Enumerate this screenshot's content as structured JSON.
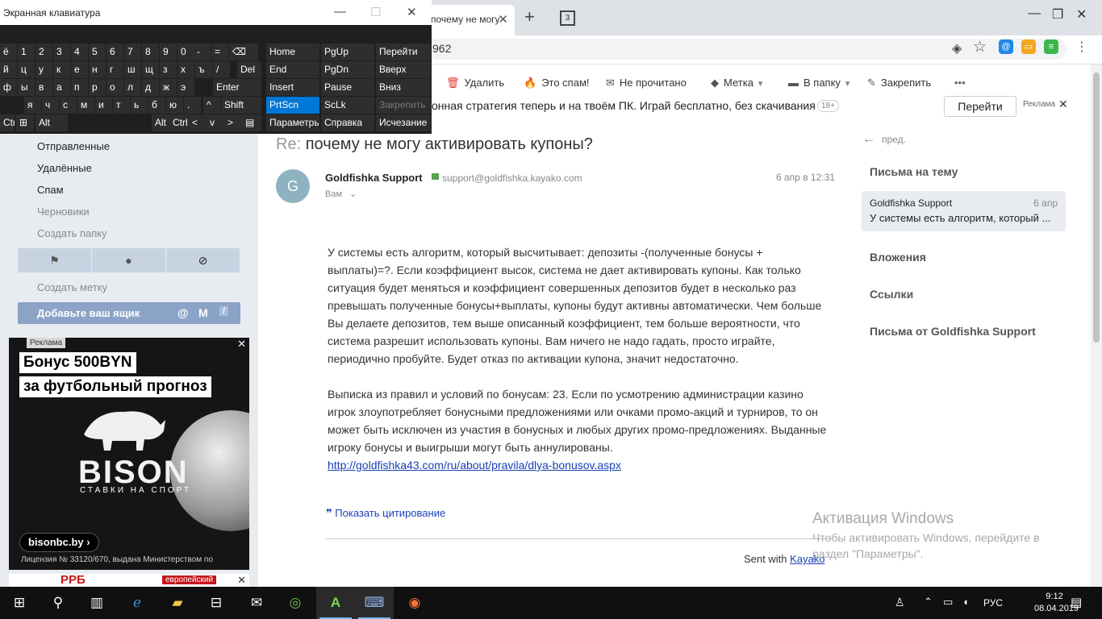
{
  "browser": {
    "tab_title": "почему не могу",
    "tab_count": "3",
    "url_fragment": "962"
  },
  "toolbar": {
    "delete": "Удалить",
    "spam": "Это спам!",
    "unread": "Не прочитано",
    "label": "Метка",
    "folder": "В папку",
    "pin": "Закрепить",
    "more": "•••"
  },
  "adstrip": {
    "text": "онная стратегия теперь и на твоём ПК. Играй бесплатно, без скачивания",
    "age": "18+",
    "go": "Перейти",
    "ad_label": "Реклама"
  },
  "sidebar": {
    "folders": [
      "Отправленные",
      "Удалённые",
      "Спам",
      "Черновики",
      "Создать папку"
    ],
    "create_label": "Создать метку",
    "add_box": "Добавьте ваш ящик"
  },
  "banner": {
    "ad_label": "Реклама",
    "line1": "Бонус 500BYN",
    "line2": "за футбольный прогноз",
    "brand": "BISON",
    "brand_sub": "СТАВКИ НА СПОРТ",
    "url": "bisonbc.by",
    "license": "Лицензия № 33120/670, выдана Министерством по",
    "banner2_brand": "РРБ",
    "banner2_tag": "европейский"
  },
  "email": {
    "subject_prefix": "Re:",
    "subject": "почему не могу активировать купоны?",
    "avatar_letter": "G",
    "sender": "Goldfishka Support",
    "sender_email": "support@goldfishka.kayako.com",
    "date": "6 апр в 12:31",
    "to": "Вам",
    "body_p1": "У системы есть алгоритм, который высчитывает: депозиты -(полученные бонусы + выплаты)=?. Если коэффициент высок, система не дает активировать купоны. Как только ситуация будет меняться и коэффициент совершенных депозитов будет в несколько раз превышать полученные бонусы+выплаты, купоны будут активны автоматически. Чем больше Вы делаете депозитов, тем выше описанный коэффициент, тем больше вероятности, что система разрешит использовать купоны. Вам ничего не надо гадать, просто играйте, периодично пробуйте. Будет отказ по активации купона, значит недостаточно.",
    "body_p2": "Выписка из правил и условий по бонусам: 23. Если по усмотрению администрации казино игрок злоупотребляет бонусными предложениями или очками промо-акций и турниров, то он может быть исключен из участия в бонусных и любых других промо-предложениях. Выданные игроку бонусы и выигрыши могут быть аннулированы.",
    "link": "http://goldfishka43.com/ru/about/pravila/dlya-bonusov.aspx",
    "show_quote": "Показать цитирование",
    "sent_with": "Sent with",
    "kayako": "Kayako"
  },
  "rightpanel": {
    "prev": "пред.",
    "thread_header": "Письма на тему",
    "thread_from": "Goldfishka Support",
    "thread_date": "6 апр",
    "thread_snippet": "У системы есть алгоритм, который ...",
    "attachments": "Вложения",
    "links": "Ссылки",
    "from_sender": "Письма от Goldfishka Support"
  },
  "watermark": {
    "title": "Активация Windows",
    "text": "Чтобы активировать Windows, перейдите в раздел \"Параметры\"."
  },
  "osk": {
    "title": "Экранная клавиатура",
    "row1": [
      "ё",
      "1",
      "2",
      "3",
      "4",
      "5",
      "6",
      "7",
      "8",
      "9",
      "0",
      "-",
      "=",
      "⌫",
      "Del"
    ],
    "row2": [
      "й",
      "ц",
      "у",
      "к",
      "е",
      "н",
      "г",
      "ш",
      "щ",
      "з",
      "х",
      "ъ",
      "/"
    ],
    "row3": [
      "ф",
      "ы",
      "в",
      "а",
      "п",
      "р",
      "о",
      "л",
      "д",
      "ж",
      "э",
      "Enter"
    ],
    "row4": [
      "я",
      "ч",
      "с",
      "м",
      "и",
      "т",
      "ь",
      "б",
      "ю",
      ".",
      "^",
      "Shift"
    ],
    "row5": [
      "Ctrl",
      "Alt",
      "Alt",
      "Ctrl",
      "<",
      "v",
      ">"
    ],
    "nav": [
      "Home",
      "PgUp",
      "Перейти",
      "End",
      "PgDn",
      "Вверх",
      "Insert",
      "Pause",
      "Вниз",
      "PrtScn",
      "ScLk",
      "Закрепить",
      "Параметры",
      "Справка",
      "Исчезание"
    ]
  },
  "tray": {
    "lang": "РУС",
    "time": "9:12",
    "date": "08.04.2019"
  }
}
